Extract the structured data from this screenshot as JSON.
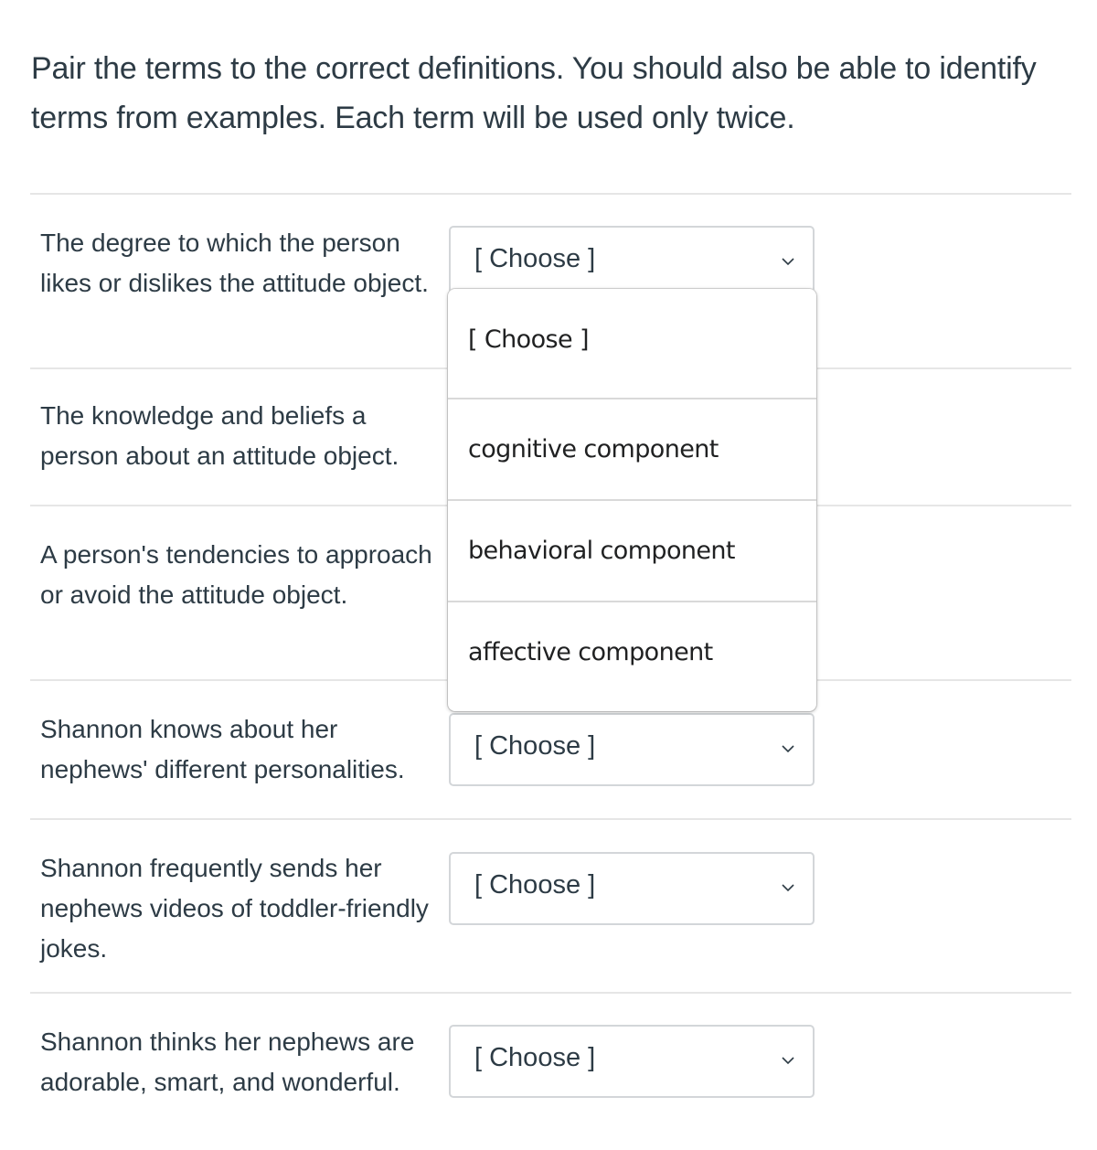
{
  "instructions": "Pair the terms to the correct definitions. You should also be able to identify terms from examples. Each term will be used only twice.",
  "questions": [
    {
      "prompt": "The degree to which the person likes or dislikes the attitude object.",
      "selected": "[ Choose ]"
    },
    {
      "prompt": "The knowledge and beliefs a person about an attitude object.",
      "selected": ""
    },
    {
      "prompt": "A person's tendencies to approach or avoid the attitude object.",
      "selected": ""
    },
    {
      "prompt": "Shannon knows about her nephews' different personalities.",
      "selected": "[ Choose ]"
    },
    {
      "prompt": "Shannon frequently sends her nephews videos of toddler-friendly jokes.",
      "selected": "[ Choose ]"
    },
    {
      "prompt": "Shannon thinks her nephews are adorable, smart, and wonderful.",
      "selected": "[ Choose ]"
    }
  ],
  "dropdown": {
    "open_for_question": 1,
    "options": [
      "[ Choose ]",
      "cognitive component",
      "behavioral component",
      "affective component"
    ]
  },
  "icons": {
    "select_arrow": "chevron-down-icon"
  }
}
